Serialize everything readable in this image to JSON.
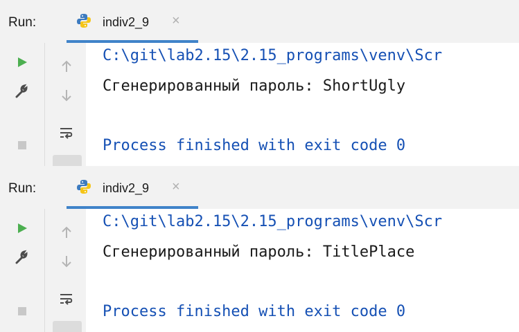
{
  "colors": {
    "accent": "#4083c9",
    "run_green": "#4caf50",
    "path_blue": "#1550b4",
    "toolbar_bg": "#f2f2f2"
  },
  "panels": [
    {
      "run_label": "Run:",
      "tab": {
        "title": "indiv2_9",
        "close": "×",
        "icon": "python-icon"
      },
      "toolbar": {
        "icons": [
          "run-icon",
          "wrench-icon",
          "stop-icon",
          "up-arrow-icon",
          "down-arrow-icon",
          "soft-wrap-icon"
        ]
      },
      "console": {
        "path": "C:\\git\\lab2.15\\2.15_programs\\venv\\Scr",
        "output": "Сгенерированный пароль: ShortUgly",
        "process": "Process finished with exit code 0"
      }
    },
    {
      "run_label": "Run:",
      "tab": {
        "title": "indiv2_9",
        "close": "×",
        "icon": "python-icon"
      },
      "toolbar": {
        "icons": [
          "run-icon",
          "wrench-icon",
          "stop-icon",
          "up-arrow-icon",
          "down-arrow-icon",
          "soft-wrap-icon"
        ]
      },
      "console": {
        "path": "C:\\git\\lab2.15\\2.15_programs\\venv\\Scr",
        "output": "Сгенерированный пароль: TitlePlace",
        "process": "Process finished with exit code 0"
      }
    }
  ]
}
